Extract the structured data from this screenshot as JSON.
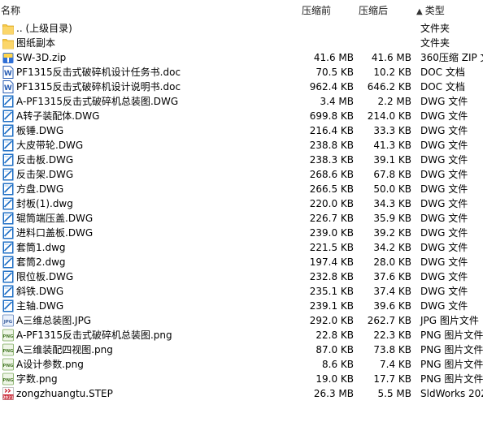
{
  "columns": {
    "name": "名称",
    "original_size": "压缩前",
    "compressed_size": "压缩后",
    "type": "类型",
    "sort_indicator": "▲"
  },
  "files": [
    {
      "name": ".. (上级目录)",
      "original": "",
      "compressed": "",
      "type": "文件夹",
      "icon": "folder-icon"
    },
    {
      "name": "图纸副本",
      "original": "",
      "compressed": "",
      "type": "文件夹",
      "icon": "folder-icon"
    },
    {
      "name": "SW-3D.zip",
      "original": "41.6 MB",
      "compressed": "41.6 MB",
      "type": "360压缩 ZIP 文",
      "icon": "zip-archive-icon"
    },
    {
      "name": "PF1315反击式破碎机设计任务书.doc",
      "original": "70.5 KB",
      "compressed": "10.2 KB",
      "type": "DOC 文档",
      "icon": "doc-file-icon"
    },
    {
      "name": "PF1315反击式破碎机设计说明书.doc",
      "original": "962.4 KB",
      "compressed": "646.2 KB",
      "type": "DOC 文档",
      "icon": "doc-file-icon"
    },
    {
      "name": "A-PF1315反击式破碎机总装图.DWG",
      "original": "3.4 MB",
      "compressed": "2.2 MB",
      "type": "DWG 文件",
      "icon": "dwg-file-icon"
    },
    {
      "name": "A转子装配体.DWG",
      "original": "699.8 KB",
      "compressed": "214.0 KB",
      "type": "DWG 文件",
      "icon": "dwg-file-icon"
    },
    {
      "name": "板锤.DWG",
      "original": "216.4 KB",
      "compressed": "33.3 KB",
      "type": "DWG 文件",
      "icon": "dwg-file-icon"
    },
    {
      "name": "大皮带轮.DWG",
      "original": "238.8 KB",
      "compressed": "41.3 KB",
      "type": "DWG 文件",
      "icon": "dwg-file-icon"
    },
    {
      "name": "反击板.DWG",
      "original": "238.3 KB",
      "compressed": "39.1 KB",
      "type": "DWG 文件",
      "icon": "dwg-file-icon"
    },
    {
      "name": "反击架.DWG",
      "original": "268.6 KB",
      "compressed": "67.8 KB",
      "type": "DWG 文件",
      "icon": "dwg-file-icon"
    },
    {
      "name": "方盘.DWG",
      "original": "266.5 KB",
      "compressed": "50.0 KB",
      "type": "DWG 文件",
      "icon": "dwg-file-icon"
    },
    {
      "name": "封板(1).dwg",
      "original": "220.0 KB",
      "compressed": "34.3 KB",
      "type": "DWG 文件",
      "icon": "dwg-file-icon"
    },
    {
      "name": "辊筒端压盖.DWG",
      "original": "226.7 KB",
      "compressed": "35.9 KB",
      "type": "DWG 文件",
      "icon": "dwg-file-icon"
    },
    {
      "name": "进料口盖板.DWG",
      "original": "239.0 KB",
      "compressed": "39.2 KB",
      "type": "DWG 文件",
      "icon": "dwg-file-icon"
    },
    {
      "name": "套筒1.dwg",
      "original": "221.5 KB",
      "compressed": "34.2 KB",
      "type": "DWG 文件",
      "icon": "dwg-file-icon"
    },
    {
      "name": "套筒2.dwg",
      "original": "197.4 KB",
      "compressed": "28.0 KB",
      "type": "DWG 文件",
      "icon": "dwg-file-icon"
    },
    {
      "name": "限位板.DWG",
      "original": "232.8 KB",
      "compressed": "37.6 KB",
      "type": "DWG 文件",
      "icon": "dwg-file-icon"
    },
    {
      "name": "斜铁.DWG",
      "original": "235.1 KB",
      "compressed": "37.4 KB",
      "type": "DWG 文件",
      "icon": "dwg-file-icon"
    },
    {
      "name": "主轴.DWG",
      "original": "239.1 KB",
      "compressed": "39.6 KB",
      "type": "DWG 文件",
      "icon": "dwg-file-icon"
    },
    {
      "name": "A三维总装图.JPG",
      "original": "292.0 KB",
      "compressed": "262.7 KB",
      "type": "JPG 图片文件",
      "icon": "jpg-image-icon"
    },
    {
      "name": "A-PF1315反击式破碎机总装图.png",
      "original": "22.8 KB",
      "compressed": "22.3 KB",
      "type": "PNG 图片文件",
      "icon": "png-image-icon"
    },
    {
      "name": "A三维装配四视图.png",
      "original": "87.0 KB",
      "compressed": "73.8 KB",
      "type": "PNG 图片文件",
      "icon": "png-image-icon"
    },
    {
      "name": "A设计参数.png",
      "original": "8.6 KB",
      "compressed": "7.4 KB",
      "type": "PNG 图片文件",
      "icon": "png-image-icon"
    },
    {
      "name": "字数.png",
      "original": "19.0 KB",
      "compressed": "17.7 KB",
      "type": "PNG 图片文件",
      "icon": "png-image-icon"
    },
    {
      "name": "zongzhuangtu.STEP",
      "original": "26.3 MB",
      "compressed": "5.5 MB",
      "type": "SldWorks 202",
      "icon": "solidworks-step-icon",
      "icon_badge": "2021"
    }
  ],
  "icon_badges": {
    "doc": "W",
    "jpg": "JPG",
    "png": "PNG"
  },
  "colors": {
    "folder": "#f7c948",
    "zip": "#2f6fd6",
    "doc": "#2b5fb5",
    "dwg": "#1f6fc5",
    "image": "#7aa85a",
    "solidworks": "#c8202f"
  }
}
